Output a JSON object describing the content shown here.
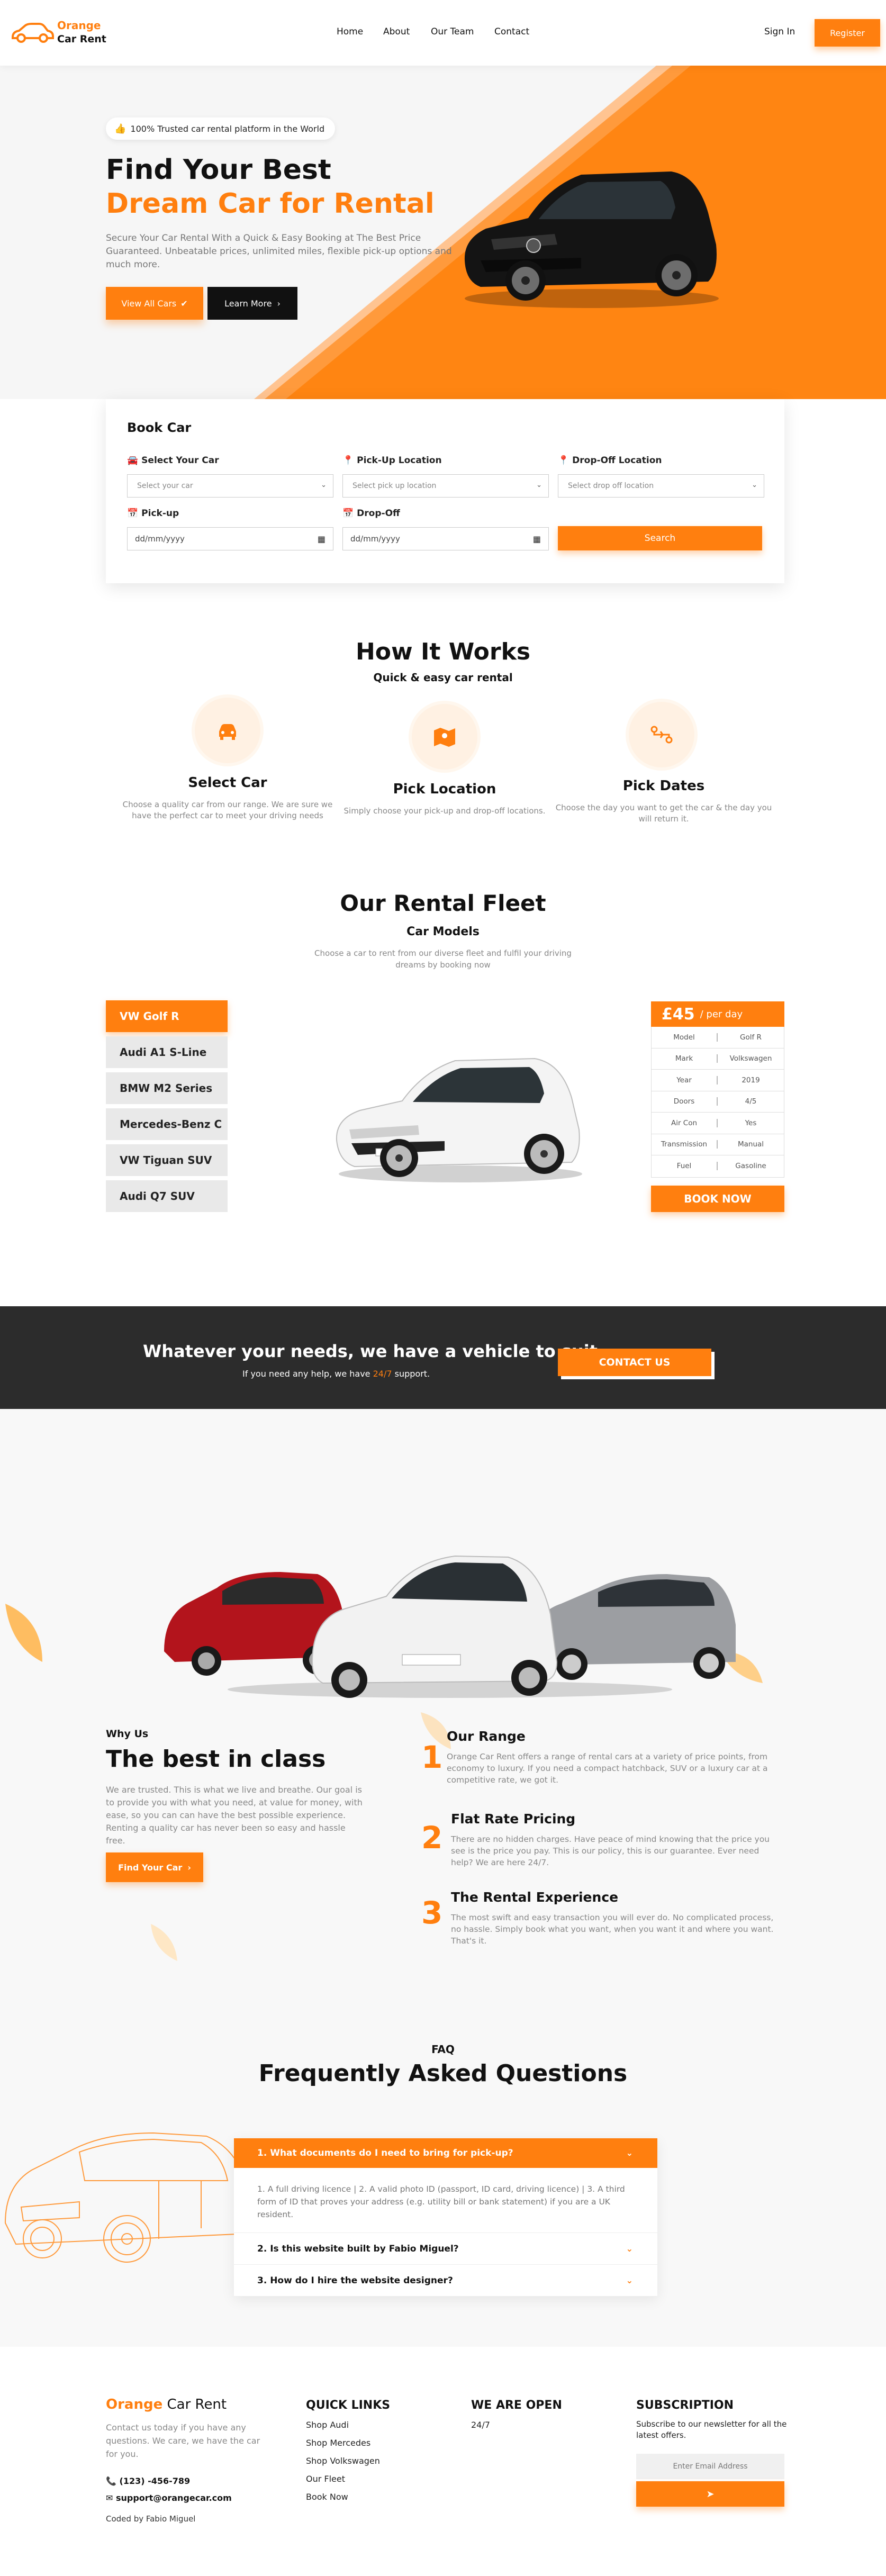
{
  "nav": {
    "logo_word1": "Orange",
    "logo_word2": "Car Rent",
    "links": [
      "Home",
      "About",
      "Our Team",
      "Contact"
    ],
    "signin": "Sign In",
    "register": "Register"
  },
  "hero": {
    "trust_badge": "100% Trusted car rental platform in the World",
    "title_line1": "Find Your Best",
    "title_line2": "Dream Car for Rental",
    "description": "Secure Your Car Rental With a Quick & Easy Booking at The Best Price Guaranteed. Unbeatable prices, unlimited miles, flexible pick-up options and much more.",
    "btn_view": "View All Cars",
    "btn_learn": "Learn More"
  },
  "booking": {
    "title": "Book Car",
    "car_label": "Select Your Car",
    "car_placeholder": "Select your car",
    "pickup_loc_label": "Pick-Up Location",
    "pickup_loc_placeholder": "Select pick up location",
    "dropoff_loc_label": "Drop-Off Location",
    "dropoff_loc_placeholder": "Select drop off location",
    "pickup_date_label": "Pick-up",
    "dropoff_date_label": "Drop-Off",
    "date_placeholder": "dd/mm/yyyy",
    "search": "Search"
  },
  "how": {
    "title": "How It Works",
    "subtitle": "Quick & easy car rental",
    "steps": [
      {
        "title": "Select Car",
        "text": "Choose a quality car from our range. We are sure we have the perfect car to meet your driving needs",
        "icon": "car-icon"
      },
      {
        "title": "Pick Location",
        "text": "Simply choose your pick-up and drop-off locations.",
        "icon": "map-icon"
      },
      {
        "title": "Pick Dates",
        "text": "Choose the day you want to get the car & the day you will return it.",
        "icon": "route-icon"
      }
    ]
  },
  "fleet": {
    "title": "Our Rental Fleet",
    "subtitle": "Car Models",
    "description": "Choose a car to rent from our diverse fleet and fulfil your driving dreams by booking now",
    "models": [
      "VW Golf R",
      "Audi A1 S-Line",
      "BMW M2 Series",
      "Mercedes-Benz C",
      "VW Tiguan SUV",
      "Audi Q7 SUV"
    ],
    "active_index": 0,
    "price": "£45",
    "per_day": "/ per day",
    "specs": [
      {
        "k": "Model",
        "v": "Golf R"
      },
      {
        "k": "Mark",
        "v": "Volkswagen"
      },
      {
        "k": "Year",
        "v": "2019"
      },
      {
        "k": "Doors",
        "v": "4/5"
      },
      {
        "k": "Air Con",
        "v": "Yes"
      },
      {
        "k": "Transmission",
        "v": "Manual"
      },
      {
        "k": "Fuel",
        "v": "Gasoline"
      }
    ],
    "book_now": "BOOK NOW"
  },
  "banner": {
    "title": "Whatever your needs, we have a vehicle to suit",
    "text_before": "If you need any help, we have ",
    "text_highlight": "24/7",
    "text_after": " support.",
    "button": "CONTACT US"
  },
  "why": {
    "label": "Why Us",
    "title": "The best in class",
    "text": "We are trusted. This is what we live and breathe. Our goal is to provide you with what you need, at value for money, with ease, so you can can have the best possible experience. Renting a quality car has never been so easy and hassle free.",
    "button": "Find Your Car",
    "features": [
      {
        "num": "1",
        "title": "Our Range",
        "text": "Orange Car Rent offers a range of rental cars at a variety of price points, from economy to luxury. If you need a compact hatchback, SUV or a luxury car at a competitive rate, we got it."
      },
      {
        "num": "2",
        "title": "Flat Rate Pricing",
        "text": "There are no hidden charges. Have peace of mind knowing that the price you see is the price you pay. This is our policy, this is our guarantee. Ever need help? We are here 24/7."
      },
      {
        "num": "3",
        "title": "The Rental Experience",
        "text": "The most swift and easy transaction you will ever do. No complicated process, no hassle. Simply book what you want, when you want it and where you want. That's it."
      }
    ]
  },
  "faq": {
    "label": "FAQ",
    "title": "Frequently Asked Questions",
    "items": [
      {
        "q": "1. What documents do I need to bring for pick-up?",
        "a": "1. A full driving licence | 2. A valid photo ID (passport, ID card, driving licence) | 3. A third form of ID that proves your address (e.g. utility bill or bank statement) if you are a UK resident."
      },
      {
        "q": "2. Is this website built by Fabio Miguel?"
      },
      {
        "q": "3. How do I hire the website designer?"
      }
    ]
  },
  "footer": {
    "brand1": "Orange",
    "brand2": " Car Rent",
    "desc": "Contact us today if you have any questions. We care, we have the car for you.",
    "phone": "(123) -456-789",
    "email": "support@orangecar.com",
    "coded": "Coded by Fabio Miguel",
    "quick_title": "QUICK LINKS",
    "quick_links": [
      "Shop Audi",
      "Shop Mercedes",
      "Shop Volkswagen",
      "Our Fleet",
      "Book Now"
    ],
    "open_title": "WE ARE OPEN",
    "open_text": "24/7",
    "sub_title": "SUBSCRIPTION",
    "sub_text": "Subscribe to our newsletter for all the latest offers.",
    "email_placeholder": "Enter Email Address"
  },
  "colors": {
    "accent": "#ff7f0f",
    "dark": "#2c2c2c"
  }
}
